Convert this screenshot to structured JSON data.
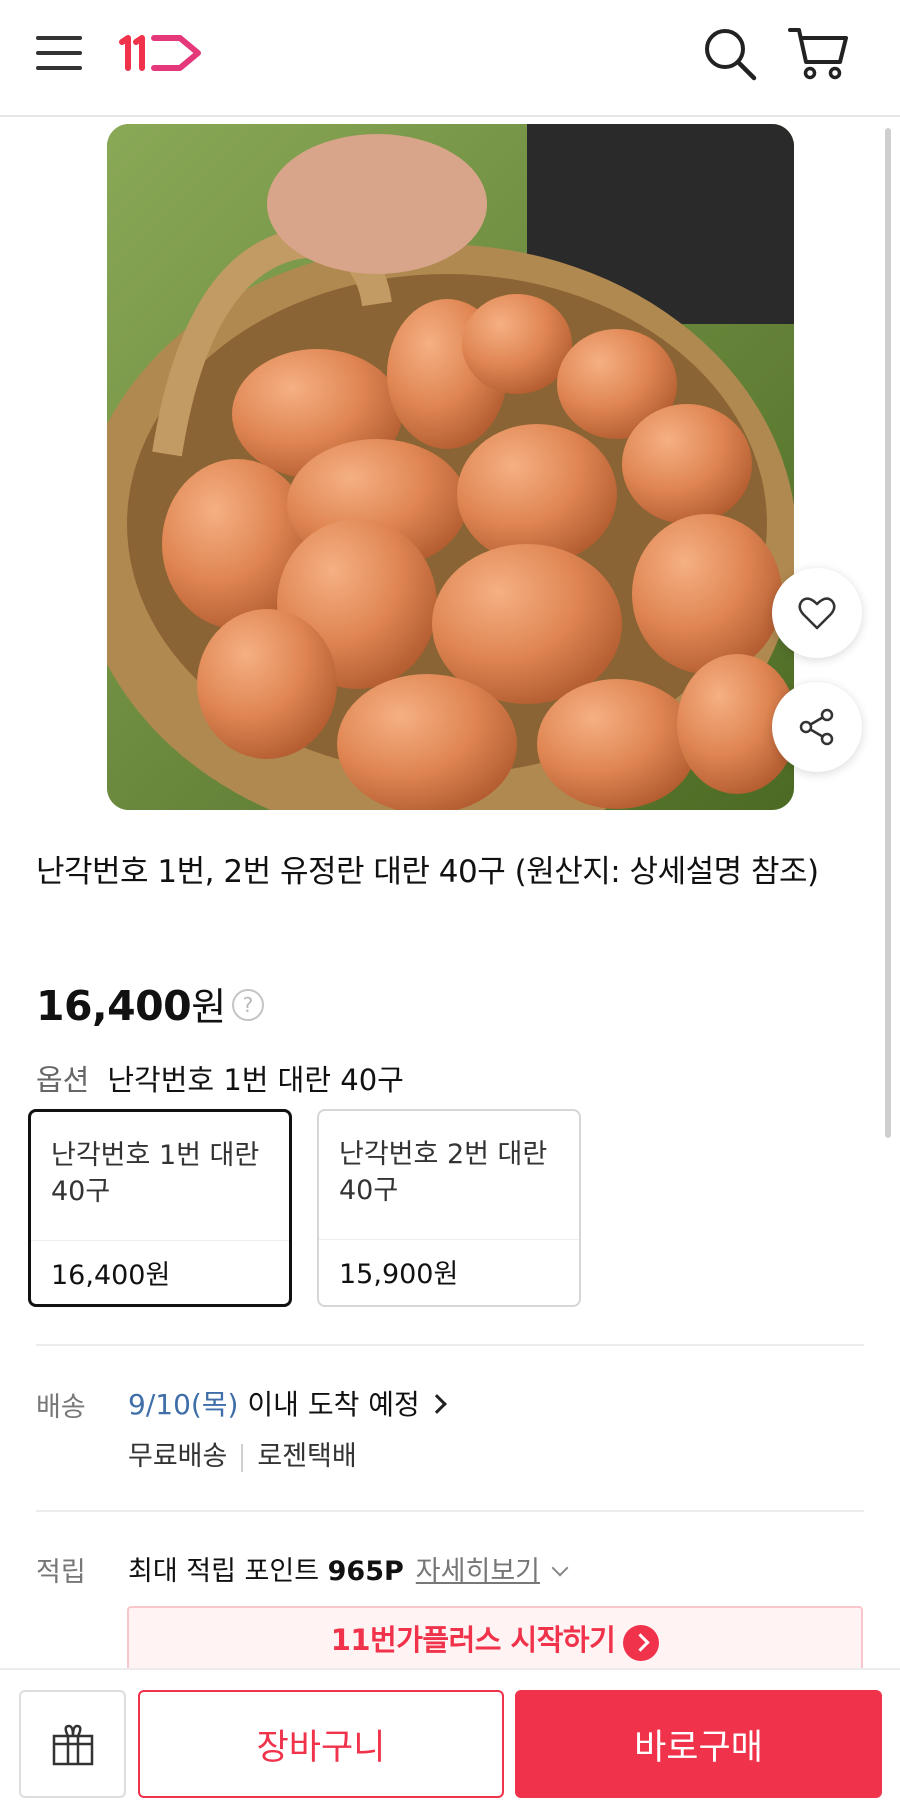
{
  "header": {
    "logo_text": "11",
    "icons": [
      "menu-icon",
      "search-icon",
      "cart-icon"
    ],
    "accent_color": "#f0324a"
  },
  "product": {
    "title": "난각번호 1번, 2번 유정란 대란 40구 (원산지: 상세설명 참조)",
    "price_value": "16,400",
    "price_unit": "원",
    "price_help": "?",
    "image_icons": [
      "heart-icon",
      "share-icon"
    ]
  },
  "option": {
    "label": "옵션",
    "selected_value": "난각번호 1번 대란 40구",
    "cards": [
      {
        "name": "난각번호 1번 대란 40구",
        "price": "16,400원",
        "selected": true
      },
      {
        "name": "난각번호 2번 대란 40구",
        "price": "15,900원",
        "selected": false
      }
    ]
  },
  "shipping": {
    "label": "배송",
    "date": "9/10(목)",
    "date_suffix": " 이내 도착 예정",
    "fee": "무료배송",
    "carrier": "로젠택배"
  },
  "points": {
    "label": "적립",
    "prefix": "최대 적립 포인트 ",
    "amount": "965P",
    "detail_link": "자세히보기"
  },
  "banner": {
    "text": "11번가플러스 시작하기"
  },
  "bottom_bar": {
    "gift_icon": "gift-icon",
    "cart_label": "장바구니",
    "buy_label": "바로구매"
  }
}
